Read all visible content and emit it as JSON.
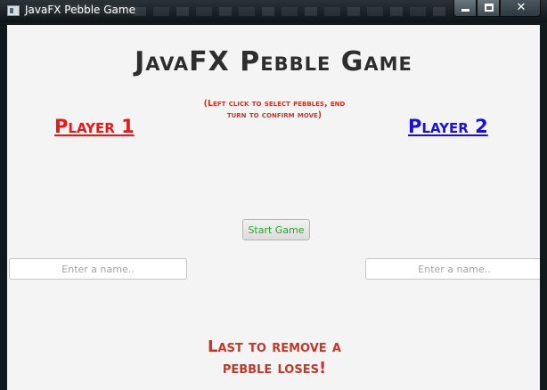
{
  "window": {
    "title": "JavaFX Pebble Game",
    "close_symbol": "✕",
    "icons": {
      "app": "app-window-icon",
      "minimize": "minimize-icon",
      "maximize": "maximize-icon",
      "close": "close-icon"
    }
  },
  "game": {
    "title": "JavaFX Pebble Game",
    "instructions_line1": "(Left click to select pebbles, end",
    "instructions_line2": "turn to confirm move)",
    "player1_label": "Player 1",
    "player2_label": "Player 2",
    "start_button_label": "Start Game",
    "player1_name_input": {
      "value": "",
      "placeholder": "Enter a name.."
    },
    "player2_name_input": {
      "value": "",
      "placeholder": "Enter a name.."
    },
    "footer_line1": "Last to remove a",
    "footer_line2": "pebble loses!"
  },
  "colors": {
    "background": "#f4f4f4",
    "title_text": "#2e2e2e",
    "player1": "#e01b1b",
    "player2": "#1a10d6",
    "message_red": "#c0392b",
    "start_button_text": "#2aa52a"
  }
}
